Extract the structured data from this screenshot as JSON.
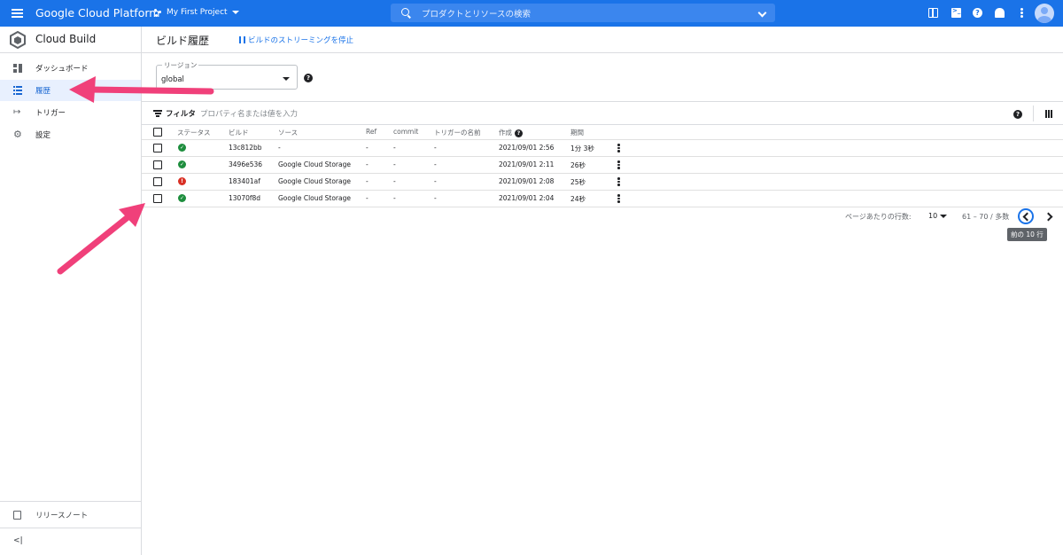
{
  "topbar": {
    "brand": "Google Cloud Platform",
    "project": "My First Project",
    "search_placeholder": "プロダクトとリソースの検索",
    "icons": [
      "menu-icon",
      "gift-icon",
      "cloud-shell-icon",
      "help-icon",
      "notifications-icon",
      "more-vert-icon",
      "account-avatar"
    ]
  },
  "sidebar": {
    "title": "Cloud Build",
    "items": [
      {
        "label": "ダッシュボード",
        "icon": "dashboard-icon"
      },
      {
        "label": "履歴",
        "icon": "list-icon",
        "active": true
      },
      {
        "label": "トリガー",
        "icon": "trigger-icon"
      },
      {
        "label": "設定",
        "icon": "gear-icon"
      }
    ],
    "release_notes": "リリースノート",
    "collapse": "<|"
  },
  "page": {
    "title": "ビルド履歴",
    "stream_button": "ビルドのストリーミングを停止",
    "region_label": "リージョン",
    "region_value": "global"
  },
  "filter": {
    "label": "フィルタ",
    "placeholder": "プロパティ名または値を入力"
  },
  "table": {
    "columns": [
      "ステータス",
      "ビルド",
      "ソース",
      "Ref",
      "commit",
      "トリガーの名前",
      "作成",
      "期間"
    ],
    "rows": [
      {
        "status": "success",
        "build": "13c812bb",
        "source": "-",
        "ref": "-",
        "commit": "-",
        "trigger": "-",
        "created": "2021/09/01 2:56",
        "duration": "1分 3秒"
      },
      {
        "status": "success",
        "build": "3496e536",
        "source": "Google Cloud Storage",
        "ref": "-",
        "commit": "-",
        "trigger": "-",
        "created": "2021/09/01 2:11",
        "duration": "26秒"
      },
      {
        "status": "error",
        "build": "183401af",
        "source": "Google Cloud Storage",
        "ref": "-",
        "commit": "-",
        "trigger": "-",
        "created": "2021/09/01 2:08",
        "duration": "25秒"
      },
      {
        "status": "success",
        "build": "13070f8d",
        "source": "Google Cloud Storage",
        "ref": "-",
        "commit": "-",
        "trigger": "-",
        "created": "2021/09/01 2:04",
        "duration": "24秒"
      }
    ]
  },
  "pagination": {
    "rows_per_page_label": "ページあたりの行数:",
    "rows_per_page": "10",
    "range": "61 – 70 / 多数",
    "prev_tooltip": "前の 10 行"
  },
  "colors": {
    "brand_blue": "#1a73e8",
    "success": "#1e8e3e",
    "error": "#d93025",
    "annotation_arrow": "#f0407a"
  }
}
